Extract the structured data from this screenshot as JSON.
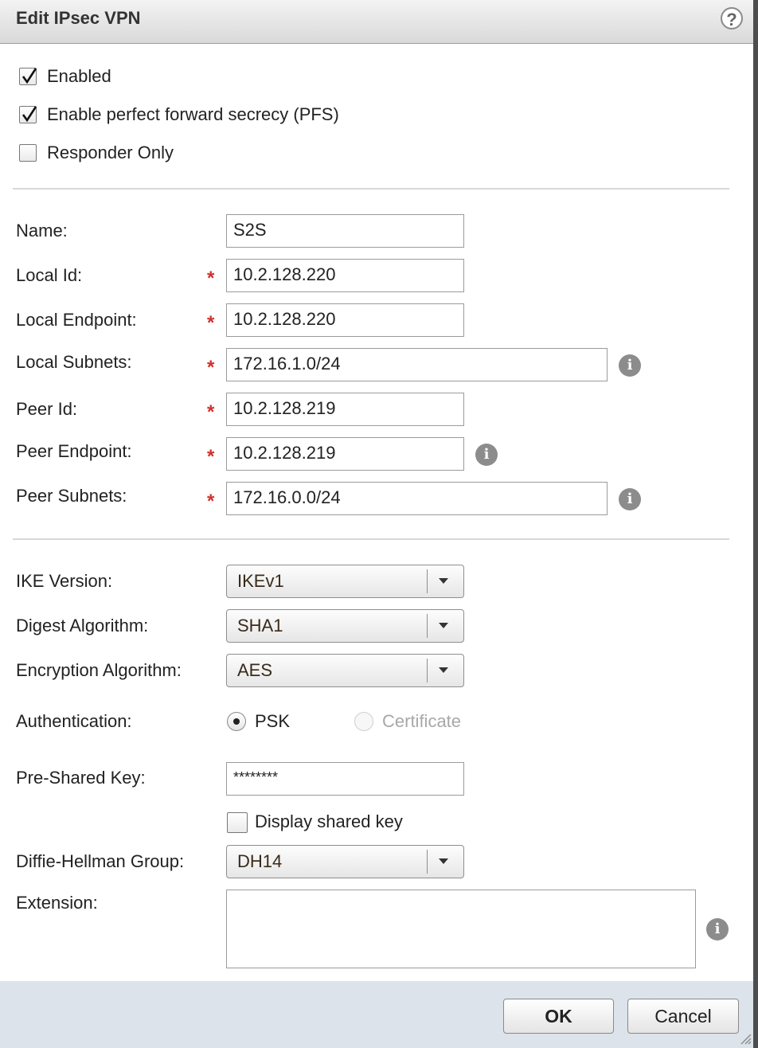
{
  "dialog": {
    "title": "Edit IPsec VPN",
    "help_icon": "question-mark-icon"
  },
  "options": {
    "enabled": {
      "label": "Enabled",
      "checked": true
    },
    "pfs": {
      "label": "Enable perfect forward secrecy (PFS)",
      "checked": true
    },
    "responder_only": {
      "label": "Responder Only",
      "checked": false
    }
  },
  "fields": {
    "name": {
      "label": "Name:",
      "value": "S2S",
      "required": false
    },
    "local_id": {
      "label": "Local Id:",
      "value": "10.2.128.220",
      "required": true
    },
    "local_endpoint": {
      "label": "Local Endpoint:",
      "value": "10.2.128.220",
      "required": true
    },
    "local_subnets": {
      "label": "Local Subnets:",
      "value": "172.16.1.0/24",
      "required": true
    },
    "peer_id": {
      "label": "Peer Id:",
      "value": "10.2.128.219",
      "required": true
    },
    "peer_endpoint": {
      "label": "Peer Endpoint:",
      "value": "10.2.128.219",
      "required": true
    },
    "peer_subnets": {
      "label": "Peer Subnets:",
      "value": "172.16.0.0/24",
      "required": true
    }
  },
  "required_marker": "*",
  "info_glyph": "i",
  "settings": {
    "ike_version": {
      "label": "IKE Version:",
      "value": "IKEv1"
    },
    "digest_algorithm": {
      "label": "Digest Algorithm:",
      "value": "SHA1"
    },
    "encryption_algorithm": {
      "label": "Encryption Algorithm:",
      "value": "AES"
    },
    "authentication": {
      "label": "Authentication:",
      "options": [
        {
          "label": "PSK",
          "selected": true,
          "disabled": false
        },
        {
          "label": "Certificate",
          "selected": false,
          "disabled": true
        }
      ]
    },
    "pre_shared_key": {
      "label": "Pre-Shared Key:",
      "value": "********"
    },
    "display_shared_key": {
      "label": "Display shared key",
      "checked": false
    },
    "dh_group": {
      "label": "Diffie-Hellman Group:",
      "value": "DH14"
    },
    "extension": {
      "label": "Extension:",
      "value": ""
    }
  },
  "buttons": {
    "ok": "OK",
    "cancel": "Cancel"
  },
  "colors": {
    "required": "#d0302a",
    "footer_bg": "#dde3ea",
    "info_icon": "#8c8c8c"
  }
}
